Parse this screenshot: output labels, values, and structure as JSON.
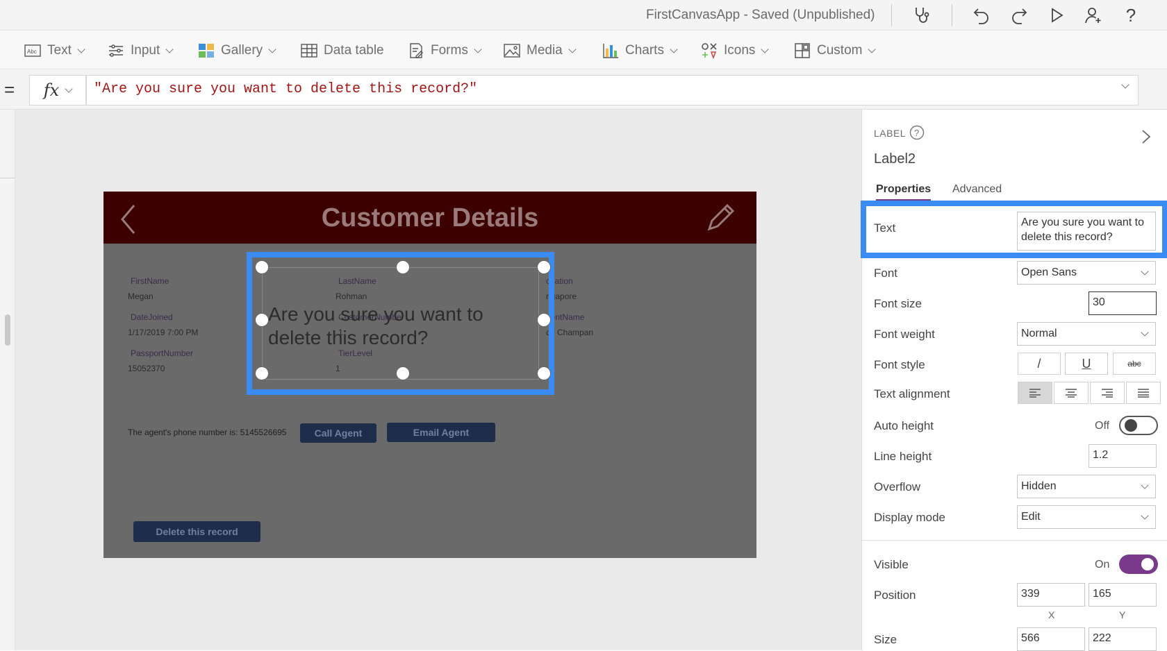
{
  "titlebar": {
    "app_title": "FirstCanvasApp - Saved (Unpublished)",
    "icons": [
      "stethoscope-icon",
      "undo-icon",
      "redo-icon",
      "play-icon",
      "share-user-icon",
      "help-icon"
    ]
  },
  "toolbar": {
    "items": [
      {
        "label": "Text",
        "icon": "text-abc-icon"
      },
      {
        "label": "Input",
        "icon": "input-sliders-icon"
      },
      {
        "label": "Gallery",
        "icon": "gallery-icon"
      },
      {
        "label": "Data table",
        "icon": "data-table-icon"
      },
      {
        "label": "Forms",
        "icon": "forms-icon"
      },
      {
        "label": "Media",
        "icon": "media-image-icon"
      },
      {
        "label": "Charts",
        "icon": "charts-icon"
      },
      {
        "label": "Icons",
        "icon": "icons-icon"
      },
      {
        "label": "Custom",
        "icon": "custom-icon"
      }
    ]
  },
  "formula": {
    "eq": "=",
    "fx": "fx",
    "value": "\"Are you sure you want to delete this record?\""
  },
  "app": {
    "header_title": "Customer Details",
    "fields": {
      "first_name_label": "FirstName",
      "first_name_value": "Megan",
      "last_name_label": "LastName",
      "last_name_value": "Rohman",
      "location_label": "ocation",
      "location_value": "ngapore",
      "date_joined_label": "DateJoined",
      "date_joined_value": "1/17/2019 7:00 PM",
      "customer_number_label": "CustomerNumber",
      "customer_number_value": "1",
      "agent_name_label": "gentName",
      "agent_name_value": "dy Champan",
      "passport_label": "PassportNumber",
      "passport_value": "15052370",
      "tier_label": "TierLevel",
      "tier_value": "1"
    },
    "agent_text": "The agent's phone number is: 5145526695",
    "call_agent": "Call Agent",
    "email_agent": "Email Agent",
    "delete_record": "Delete this record",
    "confirm_text": "Are you sure you want to delete this record?"
  },
  "panel": {
    "control_type": "LABEL",
    "control_name": "Label2",
    "tabs": {
      "properties": "Properties",
      "advanced": "Advanced"
    },
    "text_label": "Text",
    "text_value": "Are you sure you want to delete this record?",
    "font_label": "Font",
    "font_value": "Open Sans",
    "font_size_label": "Font size",
    "font_size_value": "30",
    "font_weight_label": "Font weight",
    "font_weight_value": "Normal",
    "font_style_label": "Font style",
    "font_style_buttons": [
      "/",
      "U",
      "abc"
    ],
    "text_alignment_label": "Text alignment",
    "auto_height_label": "Auto height",
    "auto_height_value": "Off",
    "line_height_label": "Line height",
    "line_height_value": "1.2",
    "overflow_label": "Overflow",
    "overflow_value": "Hidden",
    "display_mode_label": "Display mode",
    "display_mode_value": "Edit",
    "visible_label": "Visible",
    "visible_value": "On",
    "position_label": "Position",
    "position_x": "339",
    "position_y": "165",
    "x_label": "X",
    "y_label": "Y",
    "size_label": "Size",
    "size_w": "566",
    "size_h": "222"
  },
  "colors": {
    "accent": "#7a3a8c",
    "selection": "#3b8bf5",
    "header": "#3d0000"
  }
}
